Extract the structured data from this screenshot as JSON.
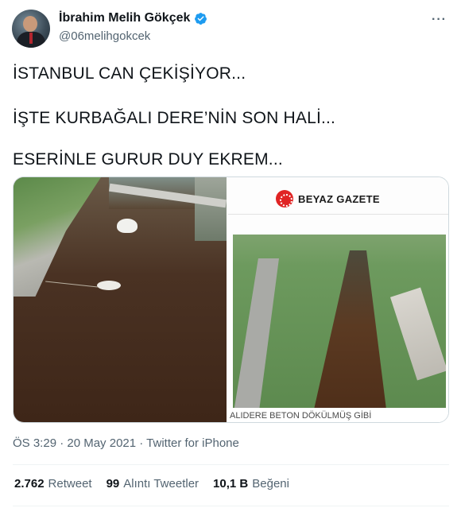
{
  "author": {
    "display_name": "İbrahim Melih Gökçek",
    "handle": "@06melihgokcek",
    "verified": true,
    "avatar_icon": "profile-photo"
  },
  "more_label": "···",
  "tweet_lines": [
    "İSTANBUL CAN ÇEKİŞİYOR...",
    "İŞTE KURBAĞALI DERE’NİN SON HALİ...",
    "ESERİNLE GURUR DUY EKREM..."
  ],
  "media": {
    "right_logo": "BEYAZ GAZETE",
    "right_caption": "ALIDERE BETON DÖKÜLMÜŞ GİBİ"
  },
  "meta": {
    "time_date_source": "ÖS 3:29 · 20 May 2021 · Twitter for iPhone"
  },
  "stats": [
    {
      "num": "2.762",
      "label": "Retweet"
    },
    {
      "num": "99",
      "label": "Alıntı Tweetler"
    },
    {
      "num": "10,1 B",
      "label": "Beğeni"
    }
  ],
  "colors": {
    "verified": "#1d9bf0",
    "text": "#0f1419",
    "secondary": "#536471",
    "logo_red": "#e02424"
  }
}
